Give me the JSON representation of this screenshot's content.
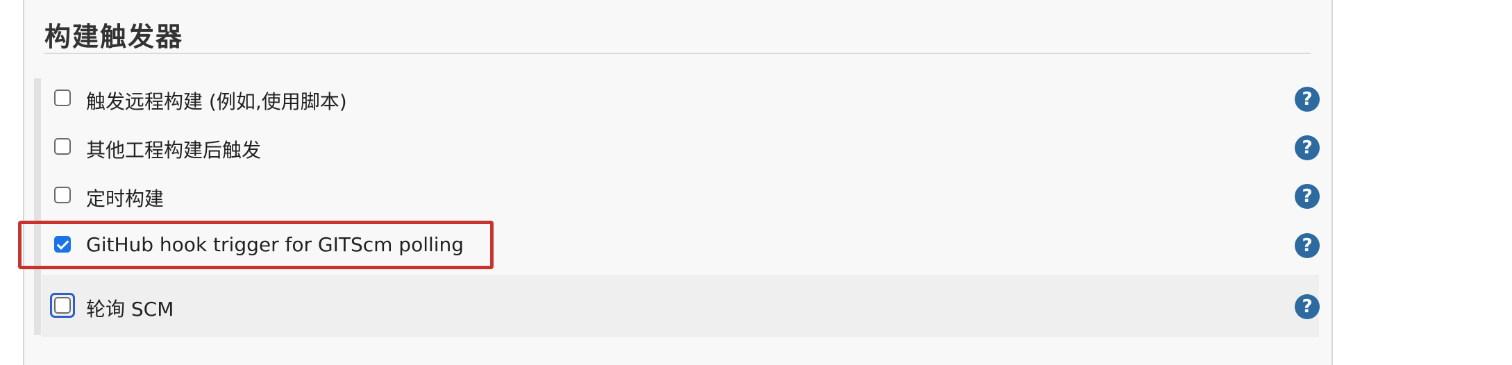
{
  "section": {
    "title": "构建触发器"
  },
  "triggers": [
    {
      "label": "触发远程构建 (例如,使用脚本)",
      "checked": false,
      "help": "?"
    },
    {
      "label": "其他工程构建后触发",
      "checked": false,
      "help": "?"
    },
    {
      "label": "定时构建",
      "checked": false,
      "help": "?"
    },
    {
      "label": "GitHub hook trigger for GITScm polling",
      "checked": true,
      "help": "?"
    },
    {
      "label": "轮询 SCM",
      "checked": false,
      "help": "?"
    }
  ],
  "colors": {
    "highlight_box": "#c8342d",
    "help_icon": "#2c6aa0",
    "checkbox_checked": "#1a73e8",
    "focus_ring": "#2d5ec9"
  }
}
